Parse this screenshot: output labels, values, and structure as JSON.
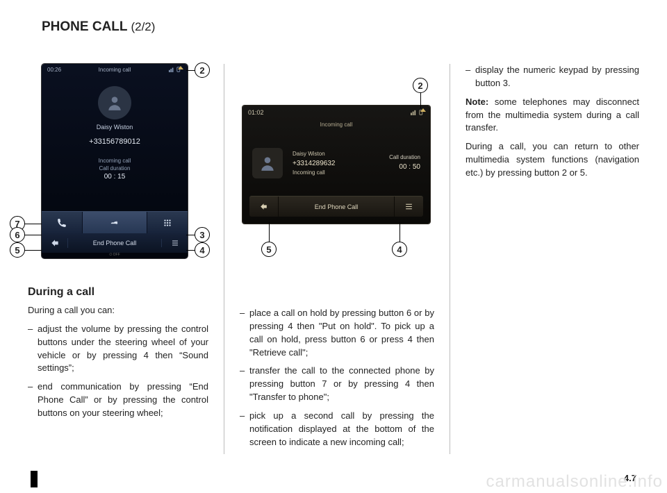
{
  "title": {
    "main": "PHONE CALL",
    "part": "(2/2)"
  },
  "page_number": "4.7",
  "watermark": "carmanualsonline.info",
  "col1": {
    "heading": "During a call",
    "intro": "During a call you can:",
    "items": [
      "adjust the volume by pressing the control buttons under the steering wheel of your vehicle or by pressing 4 then “Sound settings”;",
      "end communication by pressing “End Phone Call” or by pressing the control buttons on your steering wheel;"
    ]
  },
  "col2": {
    "items": [
      "place a call on hold by pressing button 6 or by pressing 4 then \"Put on hold\". To pick up a call on hold, press button 6 or press 4 then \"Retrieve call\";",
      "transfer the call to the connected phone by pressing button 7 or by pressing 4 then \"Transfer to phone\";",
      "pick up a second call by pressing the notification displayed at the bottom of the screen to indicate a new incoming call;"
    ]
  },
  "col3": {
    "items": [
      "display the numeric keypad by pressing button 3."
    ],
    "note_label": "Note:",
    "note": "some telephones may disconnect from the multimedia system during a call transfer.",
    "p2": "During a call, you can return to other multimedia system functions (navigation etc.) by pressing button 2 or 5."
  },
  "callouts": {
    "b2": "2",
    "b3": "3",
    "b4": "4",
    "b5": "5",
    "b6": "6",
    "b7": "7"
  },
  "screen1": {
    "clock": "00:26",
    "header": "Incoming call",
    "name": "Daisy Wiston",
    "number": "+33156789012",
    "sub1": "Incoming call",
    "sub2": "Call duration",
    "duration": "00 : 15",
    "end_label": "End Phone Call",
    "off": "OFF",
    "icons": {
      "status_signal": "signal-icon",
      "status_cell": "cell-icon",
      "status_chevron": "expand-up-icon",
      "bar_hold": "handset-icon",
      "bar_car": "car-phone-icon",
      "bar_keypad": "keypad-icon",
      "back": "back-arrow-icon",
      "menu": "list-menu-icon"
    }
  },
  "screen2": {
    "clock": "01:02",
    "header": "Incoming call",
    "name": "Daisy Wiston",
    "number": "+3314289632",
    "sub": "Incoming call",
    "dur_label": "Call duration",
    "duration": "00 : 50",
    "end_label": "End Phone Call",
    "icons": {
      "back": "back-arrow-icon",
      "menu": "list-menu-icon",
      "status_chevron": "expand-up-icon"
    }
  }
}
